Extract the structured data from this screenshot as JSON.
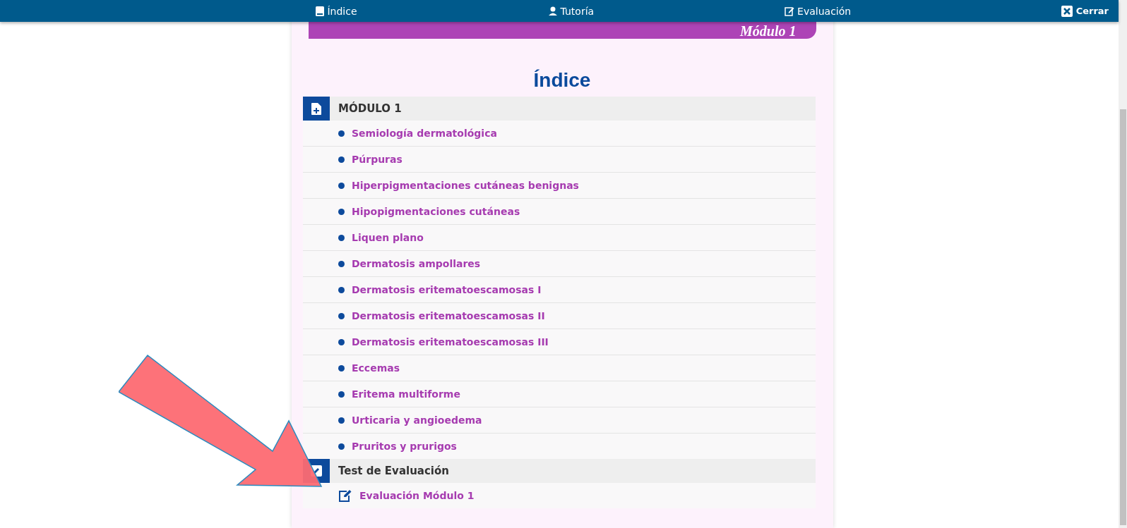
{
  "nav": {
    "items": [
      {
        "label": "Índice",
        "kind": "book"
      },
      {
        "label": "Tutoría",
        "kind": "tutor"
      },
      {
        "label": "Evaluación",
        "kind": "edit"
      }
    ],
    "close": "Cerrar"
  },
  "banner": {
    "title": "Módulo 1"
  },
  "title": "Índice",
  "sections": [
    {
      "title": "MÓDULO 1",
      "kind": "module",
      "items": [
        {
          "label": "Semiología dermatológica",
          "kind": "topic"
        },
        {
          "label": "Púrpuras",
          "kind": "topic"
        },
        {
          "label": "Hiperpigmentaciones cutáneas benignas",
          "kind": "topic"
        },
        {
          "label": "Hipopigmentaciones cutáneas",
          "kind": "topic"
        },
        {
          "label": "Liquen plano",
          "kind": "topic"
        },
        {
          "label": "Dermatosis ampollares",
          "kind": "topic"
        },
        {
          "label": "Dermatosis eritematoescamosas I",
          "kind": "topic"
        },
        {
          "label": "Dermatosis eritematoescamosas II",
          "kind": "topic"
        },
        {
          "label": "Dermatosis eritematoescamosas III",
          "kind": "topic"
        },
        {
          "label": "Eccemas",
          "kind": "topic"
        },
        {
          "label": "Eritema multiforme",
          "kind": "topic"
        },
        {
          "label": "Urticaria y angioedema",
          "kind": "topic"
        },
        {
          "label": "Pruritos y prurigos",
          "kind": "topic"
        }
      ]
    },
    {
      "title": "Test de Evaluación",
      "kind": "test",
      "items": [
        {
          "label": "Evaluación Módulo 1",
          "kind": "test"
        }
      ]
    }
  ]
}
